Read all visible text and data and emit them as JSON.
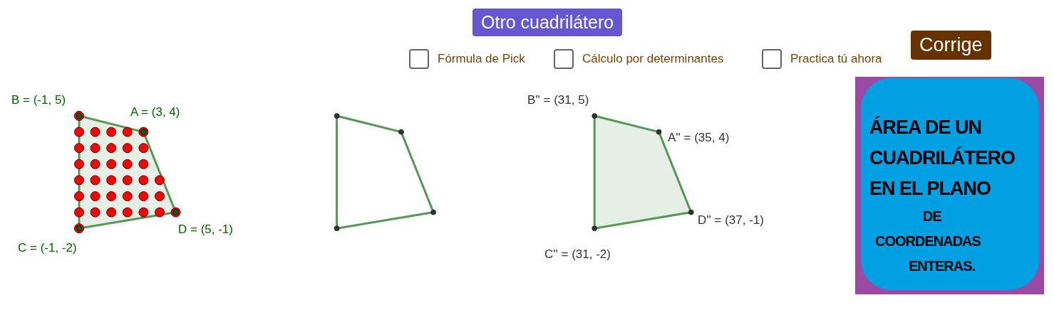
{
  "buttons": [
    {
      "kind": "new",
      "label": "Otro cuadrilátero"
    },
    {
      "kind": "check",
      "label": "Corrige"
    }
  ],
  "checkboxes": [
    {
      "label": "Fórmula de Pick",
      "checked": false
    },
    {
      "label": "Cálculo por determinantes",
      "checked": false
    },
    {
      "label": "Practica tú ahora",
      "checked": false
    }
  ],
  "figures": [
    {
      "kind": "lattice",
      "labels": [
        "A = (3, 4)",
        "B = (-1, 5)",
        "C = (-1, -2)",
        "D = (5, -1)"
      ]
    },
    {
      "kind": "outline"
    },
    {
      "kind": "shaded",
      "labels": [
        "A'' = (35, 4)",
        "B'' = (31, 5)",
        "C'' = (31, -2)",
        "D'' = (37, -1)"
      ]
    }
  ],
  "title_card": {
    "lines": [
      "ÁREA DE UN",
      "CUADRILÁTERO",
      "EN EL PLANO",
      "DE",
      "COORDENADAS",
      "ENTERAS."
    ]
  }
}
